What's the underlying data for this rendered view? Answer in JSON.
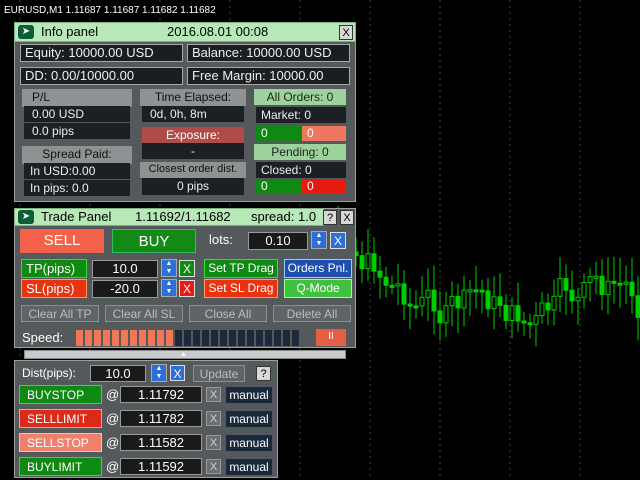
{
  "chart": {
    "title": "EURUSD,M1  1.11687 1.11687 1.11682 1.11682",
    "colors": {
      "bull": "#00cc00",
      "bear": "#00cc00",
      "grid": "#444444"
    }
  },
  "info_panel": {
    "title": "Info panel",
    "datetime": "2016.08.01 00:08",
    "close": "X",
    "equity": "Equity: 10000.00 USD",
    "balance": "Balance: 10000.00 USD",
    "dd": "DD: 0.00/10000.00",
    "free_margin": "Free Margin: 10000.00",
    "pl_label": "P/L",
    "pl_usd": "0.00 USD",
    "pl_pips": "0.0 pips",
    "spread_label": "Spread Paid:",
    "spread_usd": "In USD:0.00",
    "spread_pips": "In pips: 0.0",
    "time_label": "Time Elapsed:",
    "time_value": "0d, 0h, 8m",
    "exposure_label": "Exposure:",
    "exposure_value": "-",
    "closest_label": "Closest order dist.",
    "closest_value": "0 pips",
    "all_orders": "All Orders: 0",
    "market": "Market: 0",
    "market_buy": "0",
    "market_sell": "0",
    "pending": "Pending: 0",
    "closed": "Closed: 0",
    "closed_buy": "0",
    "closed_sell": "0"
  },
  "trade_panel": {
    "title": "Trade Panel",
    "price": "1.11692/1.11682",
    "spread": "spread: 1.0",
    "help": "?",
    "close": "X",
    "sell": "SELL",
    "buy": "BUY",
    "lots_label": "lots:",
    "lots_value": "0.10",
    "tp_label": "TP(pips)",
    "tp_value": "10.0",
    "sl_label": "SL(pips)",
    "sl_value": "-20.0",
    "x": "X",
    "set_tp_drag": "Set TP Drag",
    "set_sl_drag": "Set SL Drag",
    "orders_pnl": "Orders Pnl.",
    "q_mode": "Q-Mode",
    "clear_all_tp": "Clear All TP",
    "clear_all_sl": "Clear All SL",
    "close_all": "Close All",
    "delete_all": "Delete All",
    "speed_label": "Speed:",
    "speed_level": 0.42,
    "pause": "II"
  },
  "pending_panel": {
    "dist_label": "Dist(pips):",
    "dist_value": "10.0",
    "x": "X",
    "update": "Update",
    "help": "?",
    "at": "@",
    "manual": "manual",
    "orders": [
      {
        "type": "BUYSTOP",
        "price": "1.11792",
        "style": "g"
      },
      {
        "type": "SELLLIMIT",
        "price": "1.11782",
        "style": "r"
      },
      {
        "type": "SELLSTOP",
        "price": "1.11582",
        "style": "s"
      },
      {
        "type": "BUYLIMIT",
        "price": "1.11592",
        "style": "g"
      }
    ]
  }
}
